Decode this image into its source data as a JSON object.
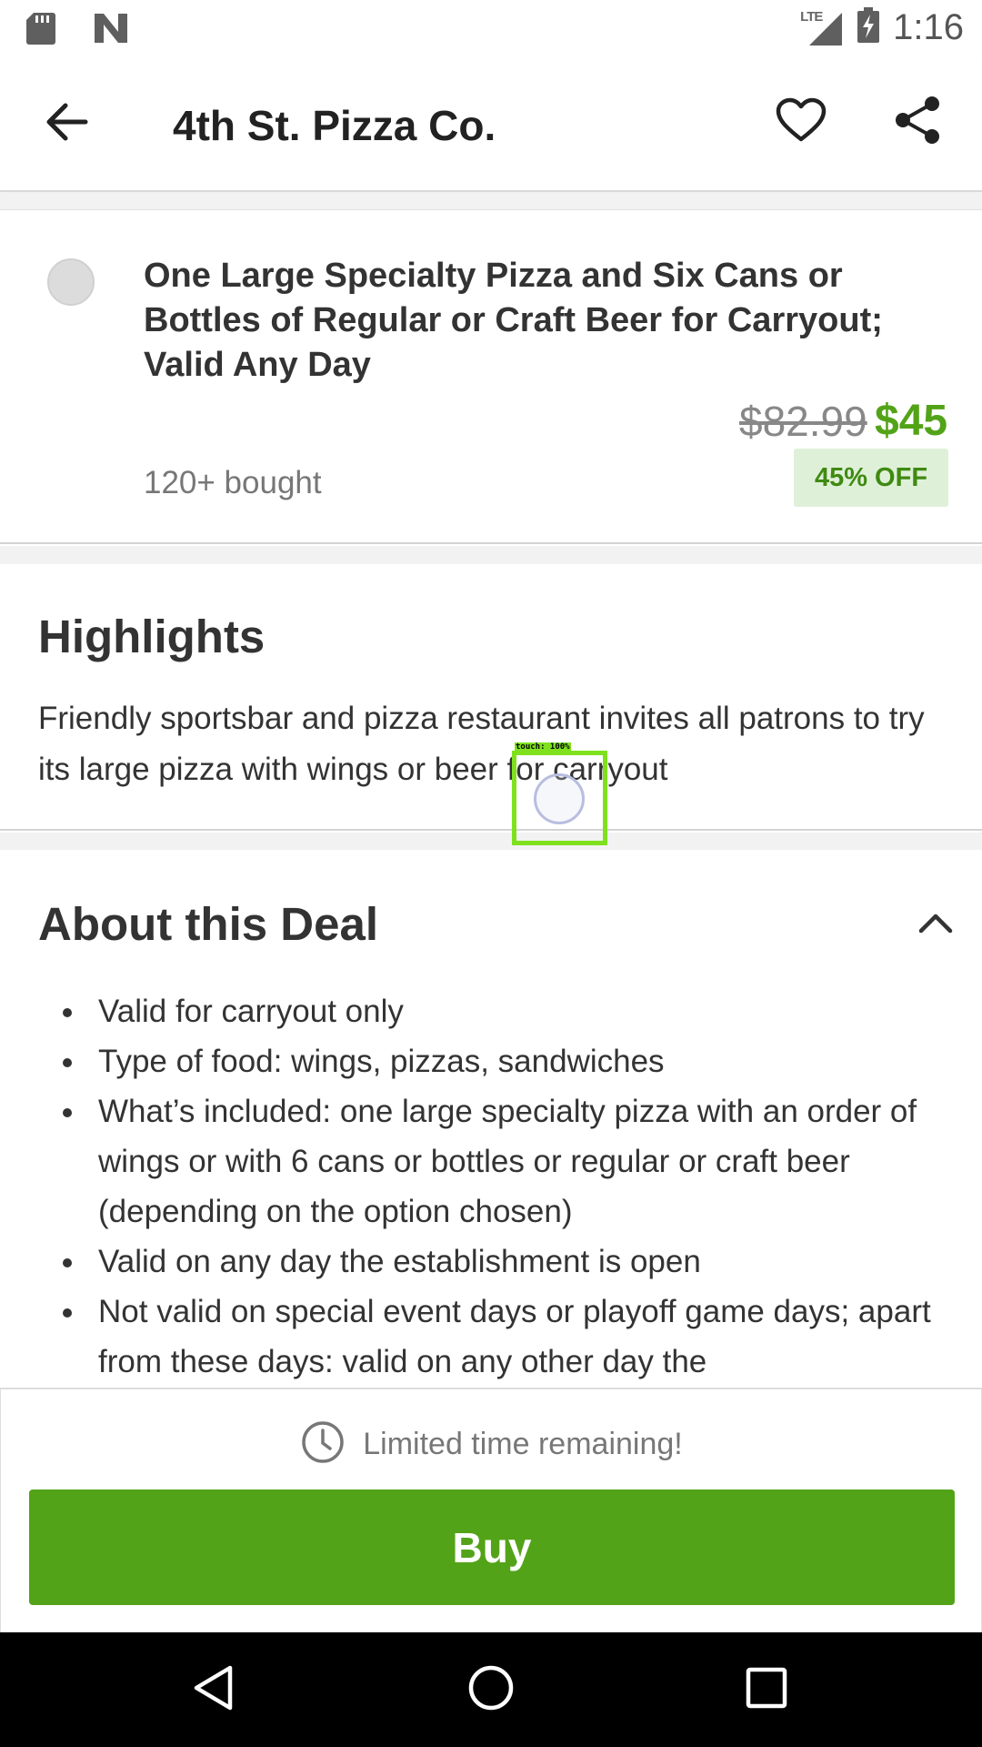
{
  "status_bar": {
    "time": "1:16",
    "network_label": "LTE",
    "icons": [
      "sd-card-icon",
      "n-logo-icon",
      "signal-icon",
      "battery-charging-icon"
    ]
  },
  "app_bar": {
    "title": "4th St. Pizza Co.",
    "icons": [
      "back-arrow-icon",
      "heart-icon",
      "share-icon"
    ]
  },
  "option": {
    "title": "One Large Specialty Pizza and Six Cans or Bottles of Regular or Craft Beer for Carryout; Valid Any Day",
    "original_price": "$82.99",
    "price": "$45",
    "bought": "120+ bought",
    "discount": "45% OFF",
    "selected": false
  },
  "highlights": {
    "heading": "Highlights",
    "text": "Friendly sportsbar and pizza restaurant invites all patrons to try its large pizza with wings or beer for carryout"
  },
  "about": {
    "heading": "About this Deal",
    "expanded": true,
    "items": [
      "Valid for carryout only",
      "Type of food: wings, pizzas, sandwiches",
      "What’s included: one large specialty pizza with an order of wings or with 6 cans or bottles or regular or craft beer (depending on the option chosen)",
      "Valid on any day the establishment is open",
      "Not valid on special event days or playoff game days; apart from these days: valid on any other day the"
    ]
  },
  "touch_indicator": {
    "label": "touch: 100%"
  },
  "buy_panel": {
    "timer_text": "Limited time remaining!",
    "buy_label": "Buy"
  },
  "nav_bar": {
    "icons": [
      "nav-back-icon",
      "nav-home-icon",
      "nav-recents-icon"
    ]
  },
  "colors": {
    "accent_green": "#53a318",
    "badge_bg": "#dff0d8",
    "badge_text": "#3f8a12",
    "touch_box": "#7fe11e"
  }
}
